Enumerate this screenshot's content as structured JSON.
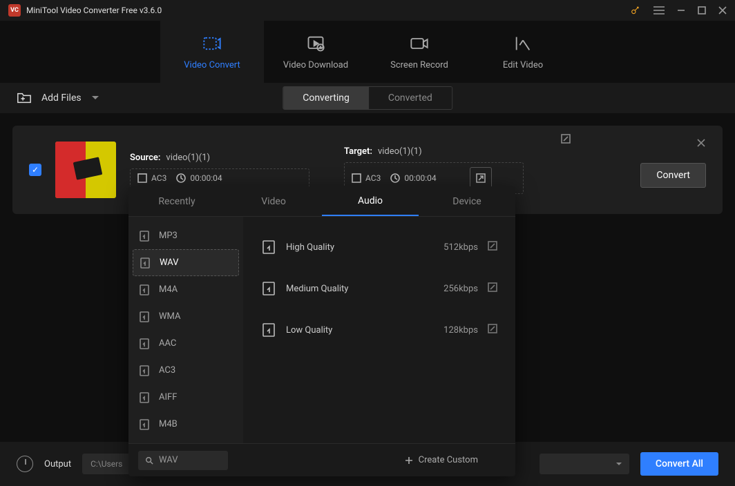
{
  "title": "MiniTool Video Converter Free v3.6.0",
  "nav": {
    "video_convert": "Video Convert",
    "video_download": "Video Download",
    "screen_record": "Screen Record",
    "edit_video": "Edit Video"
  },
  "toolbar": {
    "add_files": "Add Files",
    "converting": "Converting",
    "converted": "Converted"
  },
  "file": {
    "source_label": "Source:",
    "source_name": "video(1)(1)",
    "target_label": "Target:",
    "target_name": "video(1)(1)",
    "src_codec": "AC3",
    "src_dur": "00:00:04",
    "tgt_codec": "AC3",
    "tgt_dur": "00:00:04",
    "convert": "Convert"
  },
  "popup": {
    "tabs": {
      "recently": "Recently",
      "video": "Video",
      "audio": "Audio",
      "device": "Device"
    },
    "formats": [
      "MP3",
      "WAV",
      "M4A",
      "WMA",
      "AAC",
      "AC3",
      "AIFF",
      "M4B"
    ],
    "selected_format": "WAV",
    "qualities": [
      {
        "name": "High Quality",
        "rate": "512kbps"
      },
      {
        "name": "Medium Quality",
        "rate": "256kbps"
      },
      {
        "name": "Low Quality",
        "rate": "128kbps"
      }
    ],
    "search_value": "WAV",
    "create_custom": "Create Custom"
  },
  "bottom": {
    "output_label": "Output",
    "output_path": "C:\\Users",
    "convert_all": "Convert All"
  }
}
